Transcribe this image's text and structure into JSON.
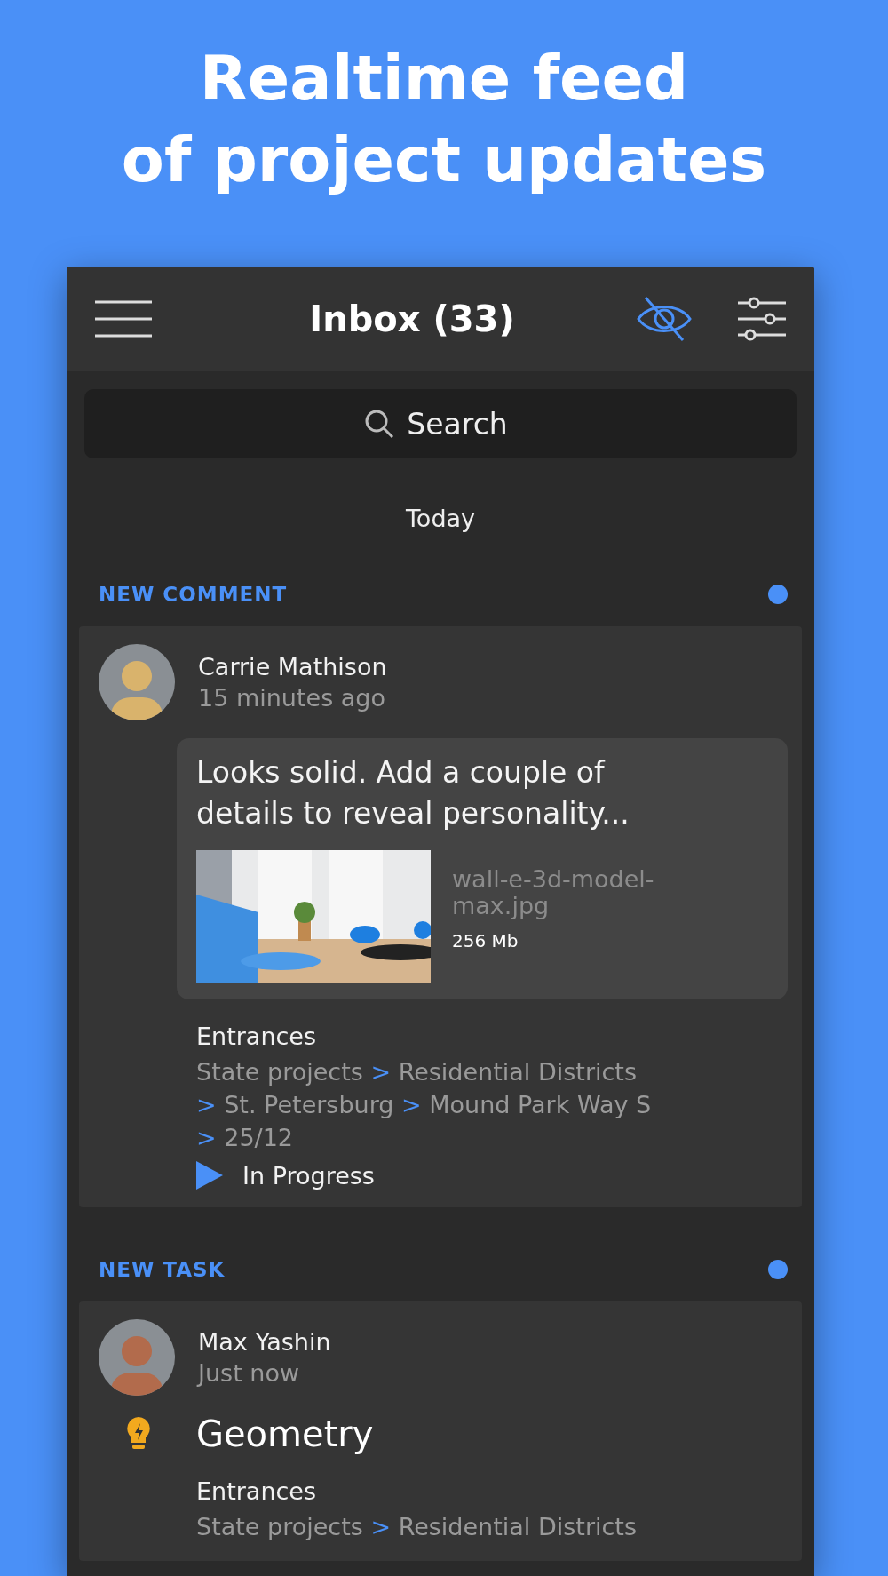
{
  "headline": [
    "Realtime feed",
    "of project updates"
  ],
  "header": {
    "title": "Inbox (33)"
  },
  "search": {
    "placeholder": "Search"
  },
  "day": "Today",
  "feed": [
    {
      "type": "NEW COMMENT",
      "unread": true,
      "author": "Carrie Mathison",
      "time": "15 minutes ago",
      "comment": "Looks solid. Add a couple of details to reveal personality...",
      "attachment": {
        "kind": "picture",
        "filename": "wall-e-3d-model-max.jpg",
        "size": "256 Mb"
      },
      "project": "Entrances",
      "separator": ">",
      "path": [
        "State projects",
        "Residential Districts",
        "St. Petersburg",
        "Mound Park Way S",
        "25/12"
      ],
      "status": "In Progress"
    },
    {
      "type": "NEW TASK",
      "unread": true,
      "author": "Max Yashin",
      "time": "Just now",
      "task": "Geometry",
      "project": "Entrances",
      "separator": ">",
      "path": [
        "State projects",
        "Residential Districts"
      ]
    }
  ]
}
